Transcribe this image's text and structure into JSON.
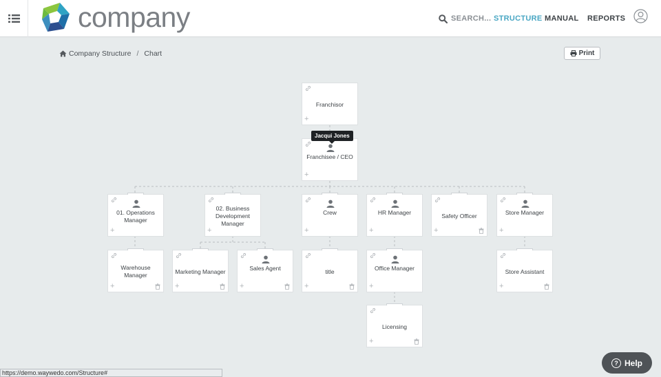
{
  "header": {
    "logo_text": "company",
    "search_label": "SEARCH...",
    "nav": {
      "structure": "STRUCTURE",
      "manual": "MANUAL",
      "reports": "REPORTS"
    }
  },
  "breadcrumb": {
    "root": "Company Structure",
    "separator": "/",
    "current": "Chart"
  },
  "toolbar": {
    "print_label": "Print"
  },
  "tooltip": {
    "text": "Jacqui Jones"
  },
  "org_chart": {
    "franchisor": {
      "title": "Franchisor"
    },
    "ceo": {
      "title": "Franchisee / CEO"
    },
    "ops_manager": {
      "title": "01. Operations Manager"
    },
    "bd_manager": {
      "title": "02. Business Development Manager"
    },
    "crew": {
      "title": "Crew"
    },
    "hr_manager": {
      "title": "HR Manager"
    },
    "safety_officer": {
      "title": "Safety Officer"
    },
    "store_manager": {
      "title": "Store Manager"
    },
    "warehouse_manager": {
      "title": "Warehouse Manager"
    },
    "marketing_manager": {
      "title": "Marketing Manager"
    },
    "sales_agent": {
      "title": "Sales Agent"
    },
    "title_role": {
      "title": "title"
    },
    "office_manager": {
      "title": "Office Manager"
    },
    "store_assistant": {
      "title": "Store Assistant"
    },
    "licensing": {
      "title": "Licensing"
    }
  },
  "status_bar": {
    "url": "https://demo.waywedo.com/Structure#"
  },
  "help": {
    "label": "Help"
  },
  "colors": {
    "accent": "#4aa7c4",
    "header_bg": "#ffffff",
    "canvas_bg": "#e7ebec"
  }
}
